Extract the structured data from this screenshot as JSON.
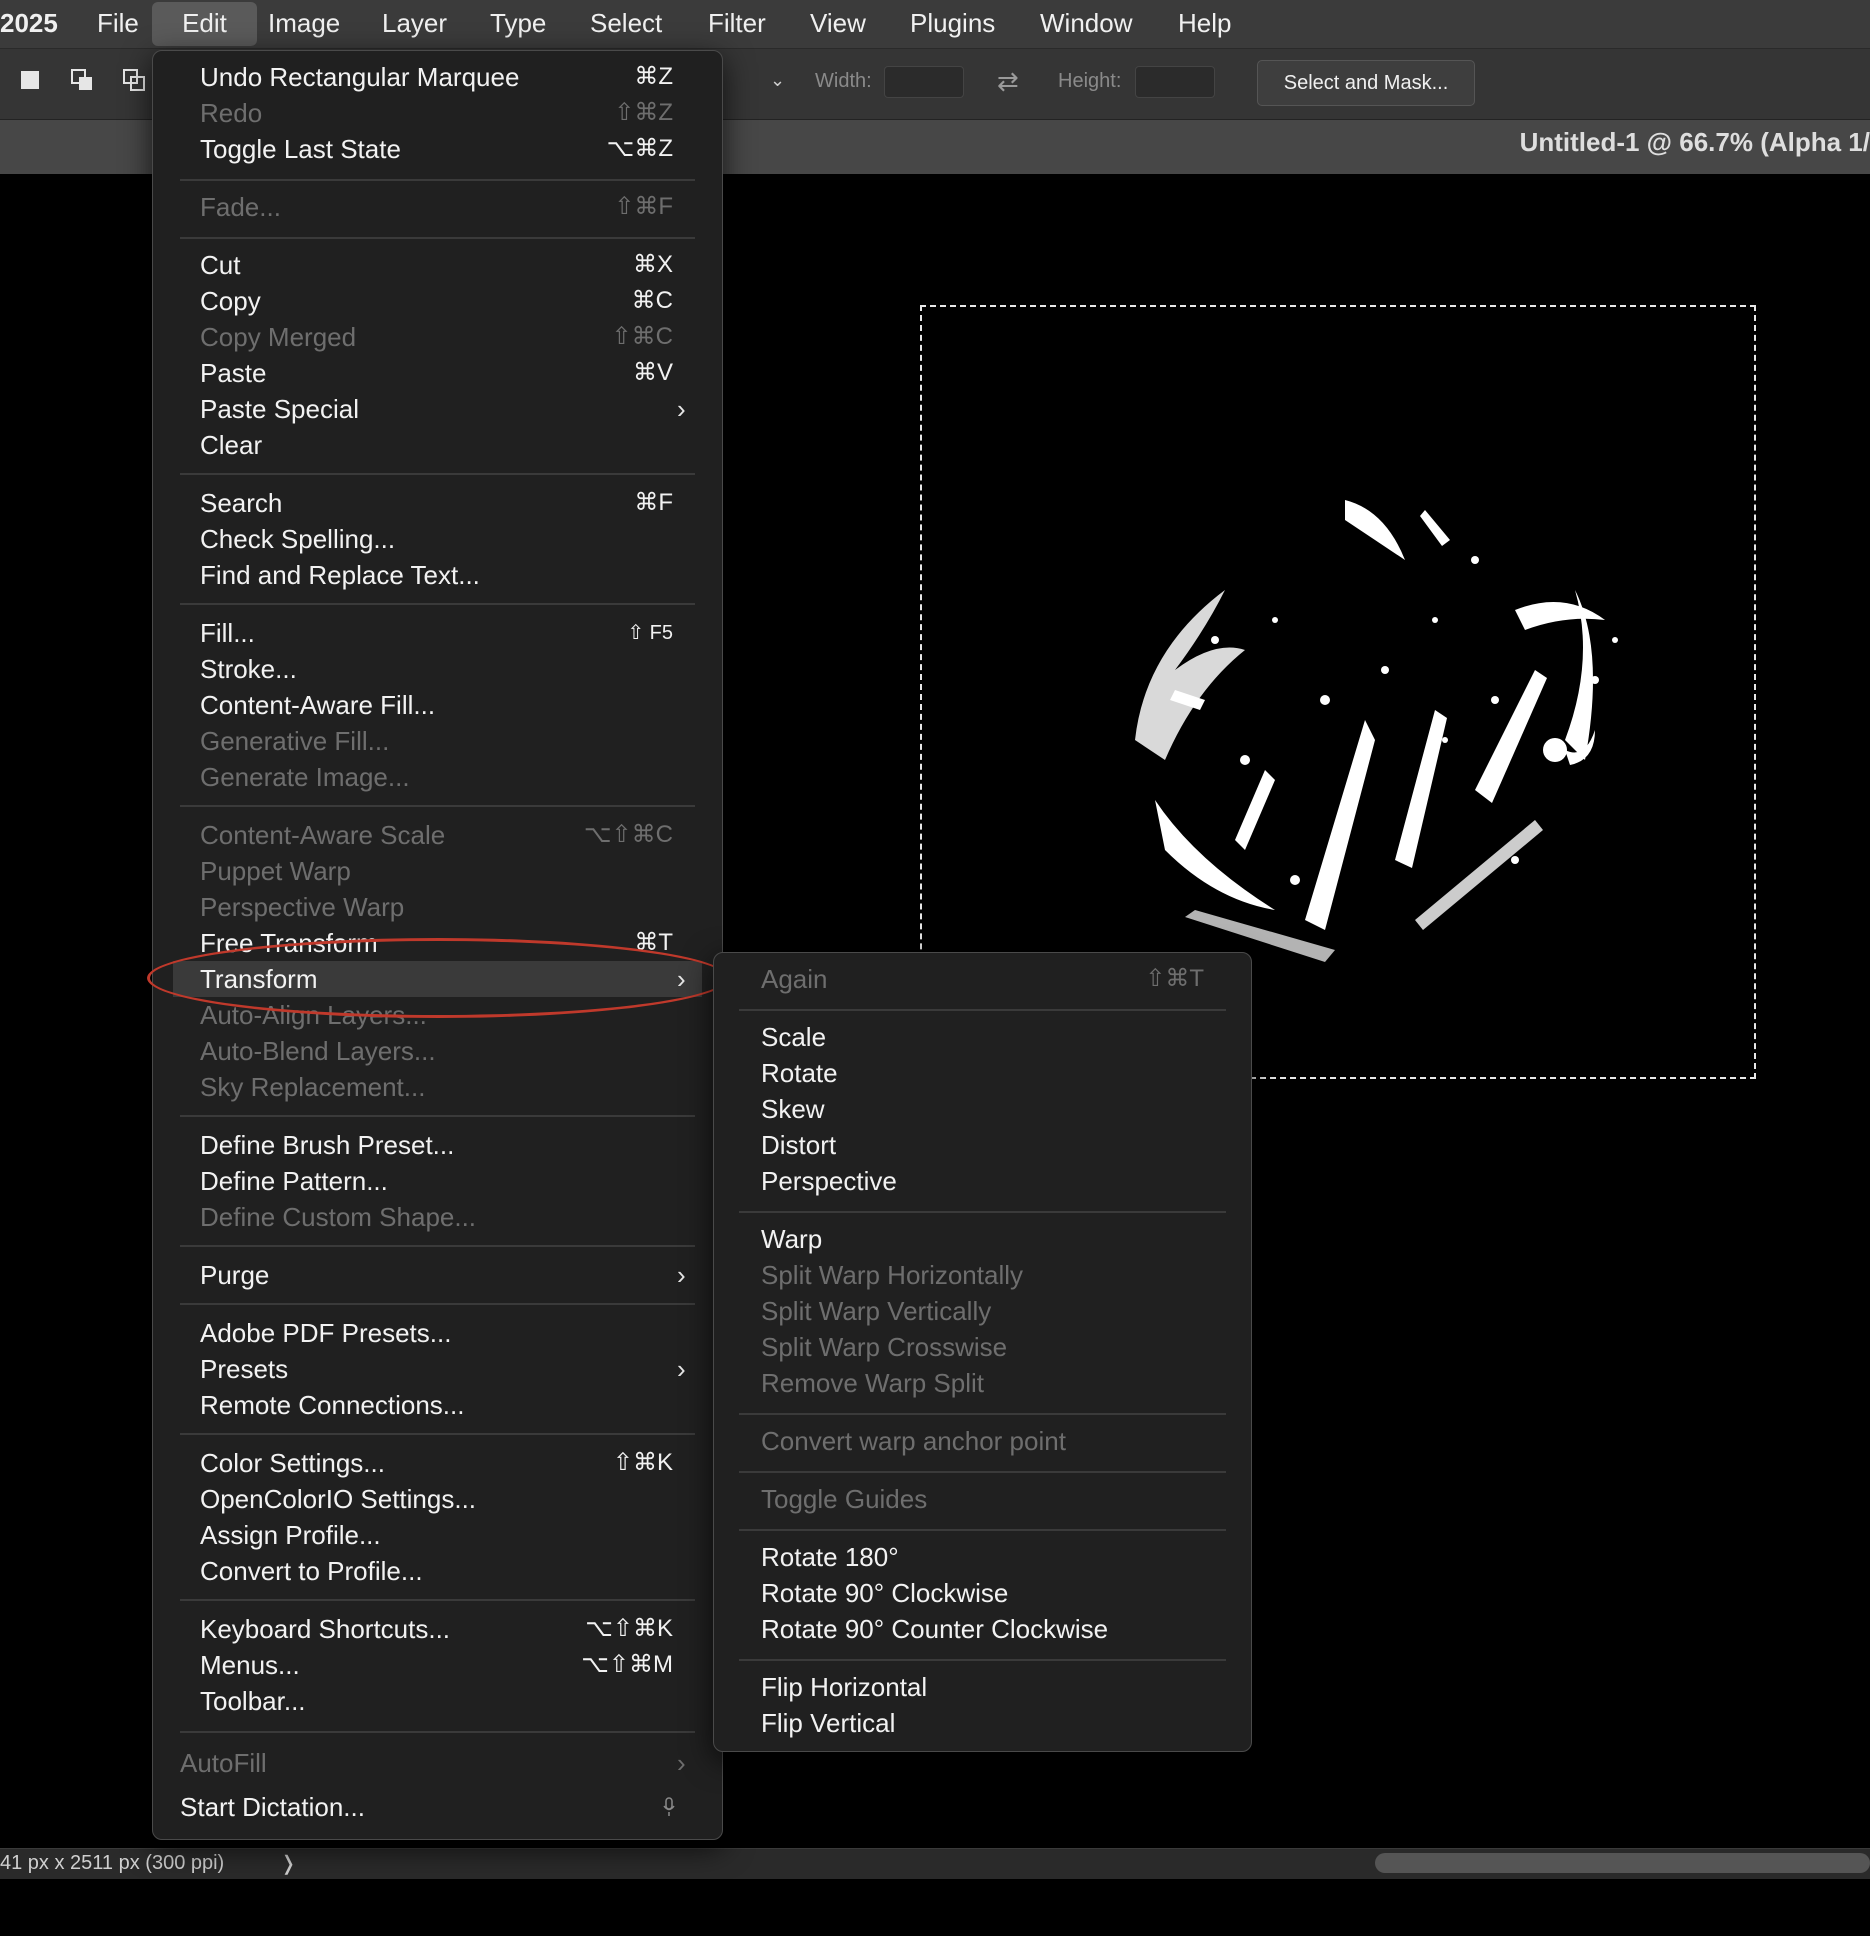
{
  "menubar": {
    "app_suffix": "2025",
    "items": [
      "File",
      "Edit",
      "Image",
      "Layer",
      "Type",
      "Select",
      "Filter",
      "View",
      "Plugins",
      "Window",
      "Help"
    ],
    "active": "Edit"
  },
  "options_bar": {
    "width_label": "Width:",
    "height_label": "Height:",
    "select_mask_label": "Select and Mask..."
  },
  "document": {
    "title": "Untitled-1 @ 66.7% (Alpha 1/"
  },
  "status": {
    "text": "41 px x 2511 px (300 ppi)",
    "chevron": "❭"
  },
  "edit_menu": {
    "items": [
      {
        "label": "Undo Rectangular Marquee",
        "shortcut": "⌘Z"
      },
      {
        "label": "Redo",
        "shortcut": "⇧⌘Z",
        "disabled": true
      },
      {
        "label": "Toggle Last State",
        "shortcut": "⌥⌘Z"
      },
      {
        "label": "Fade...",
        "shortcut": "⇧⌘F",
        "disabled": true
      },
      {
        "label": "Cut",
        "shortcut": "⌘X"
      },
      {
        "label": "Copy",
        "shortcut": "⌘C"
      },
      {
        "label": "Copy Merged",
        "shortcut": "⇧⌘C",
        "disabled": true
      },
      {
        "label": "Paste",
        "shortcut": "⌘V"
      },
      {
        "label": "Paste Special"
      },
      {
        "label": "Clear"
      },
      {
        "label": "Search",
        "shortcut": "⌘F"
      },
      {
        "label": "Check Spelling..."
      },
      {
        "label": "Find and Replace Text..."
      },
      {
        "label": "Fill...",
        "shortcut": "⇧ F5"
      },
      {
        "label": "Stroke..."
      },
      {
        "label": "Content-Aware Fill..."
      },
      {
        "label": "Generative Fill...",
        "disabled": true
      },
      {
        "label": "Generate Image...",
        "disabled": true
      },
      {
        "label": "Content-Aware Scale",
        "shortcut": "⌥⇧⌘C",
        "disabled": true
      },
      {
        "label": "Puppet Warp",
        "disabled": true
      },
      {
        "label": "Perspective Warp",
        "disabled": true
      },
      {
        "label": "Free Transform",
        "shortcut": "⌘T"
      },
      {
        "label": "Transform"
      },
      {
        "label": "Auto-Align Layers...",
        "disabled": true
      },
      {
        "label": "Auto-Blend Layers...",
        "disabled": true
      },
      {
        "label": "Sky Replacement...",
        "disabled": true
      },
      {
        "label": "Define Brush Preset..."
      },
      {
        "label": "Define Pattern..."
      },
      {
        "label": "Define Custom Shape...",
        "disabled": true
      },
      {
        "label": "Purge"
      },
      {
        "label": "Adobe PDF Presets..."
      },
      {
        "label": "Presets"
      },
      {
        "label": "Remote Connections..."
      },
      {
        "label": "Color Settings...",
        "shortcut": "⇧⌘K"
      },
      {
        "label": "OpenColorIO Settings..."
      },
      {
        "label": "Assign Profile..."
      },
      {
        "label": "Convert to Profile..."
      },
      {
        "label": "Keyboard Shortcuts...",
        "shortcut": "⌥⇧⌘K"
      },
      {
        "label": "Menus...",
        "shortcut": "⌥⇧⌘M"
      },
      {
        "label": "Toolbar..."
      },
      {
        "label": "AutoFill",
        "disabled": true
      },
      {
        "label": "Start Dictation..."
      }
    ]
  },
  "transform_submenu": {
    "items": [
      {
        "label": "Again",
        "shortcut": "⇧⌘T",
        "disabled": true
      },
      {
        "label": "Scale"
      },
      {
        "label": "Rotate"
      },
      {
        "label": "Skew"
      },
      {
        "label": "Distort"
      },
      {
        "label": "Perspective"
      },
      {
        "label": "Warp"
      },
      {
        "label": "Split Warp Horizontally",
        "disabled": true
      },
      {
        "label": "Split Warp Vertically",
        "disabled": true
      },
      {
        "label": "Split Warp Crosswise",
        "disabled": true
      },
      {
        "label": "Remove Warp Split",
        "disabled": true
      },
      {
        "label": "Convert warp anchor point",
        "disabled": true
      },
      {
        "label": "Toggle Guides",
        "disabled": true
      },
      {
        "label": "Rotate 180°"
      },
      {
        "label": "Rotate 90° Clockwise"
      },
      {
        "label": "Rotate 90° Counter Clockwise"
      },
      {
        "label": "Flip Horizontal"
      },
      {
        "label": "Flip Vertical"
      }
    ]
  },
  "colors": {
    "highlight_ring": "#c0392b",
    "menu_bg": "#202020"
  }
}
